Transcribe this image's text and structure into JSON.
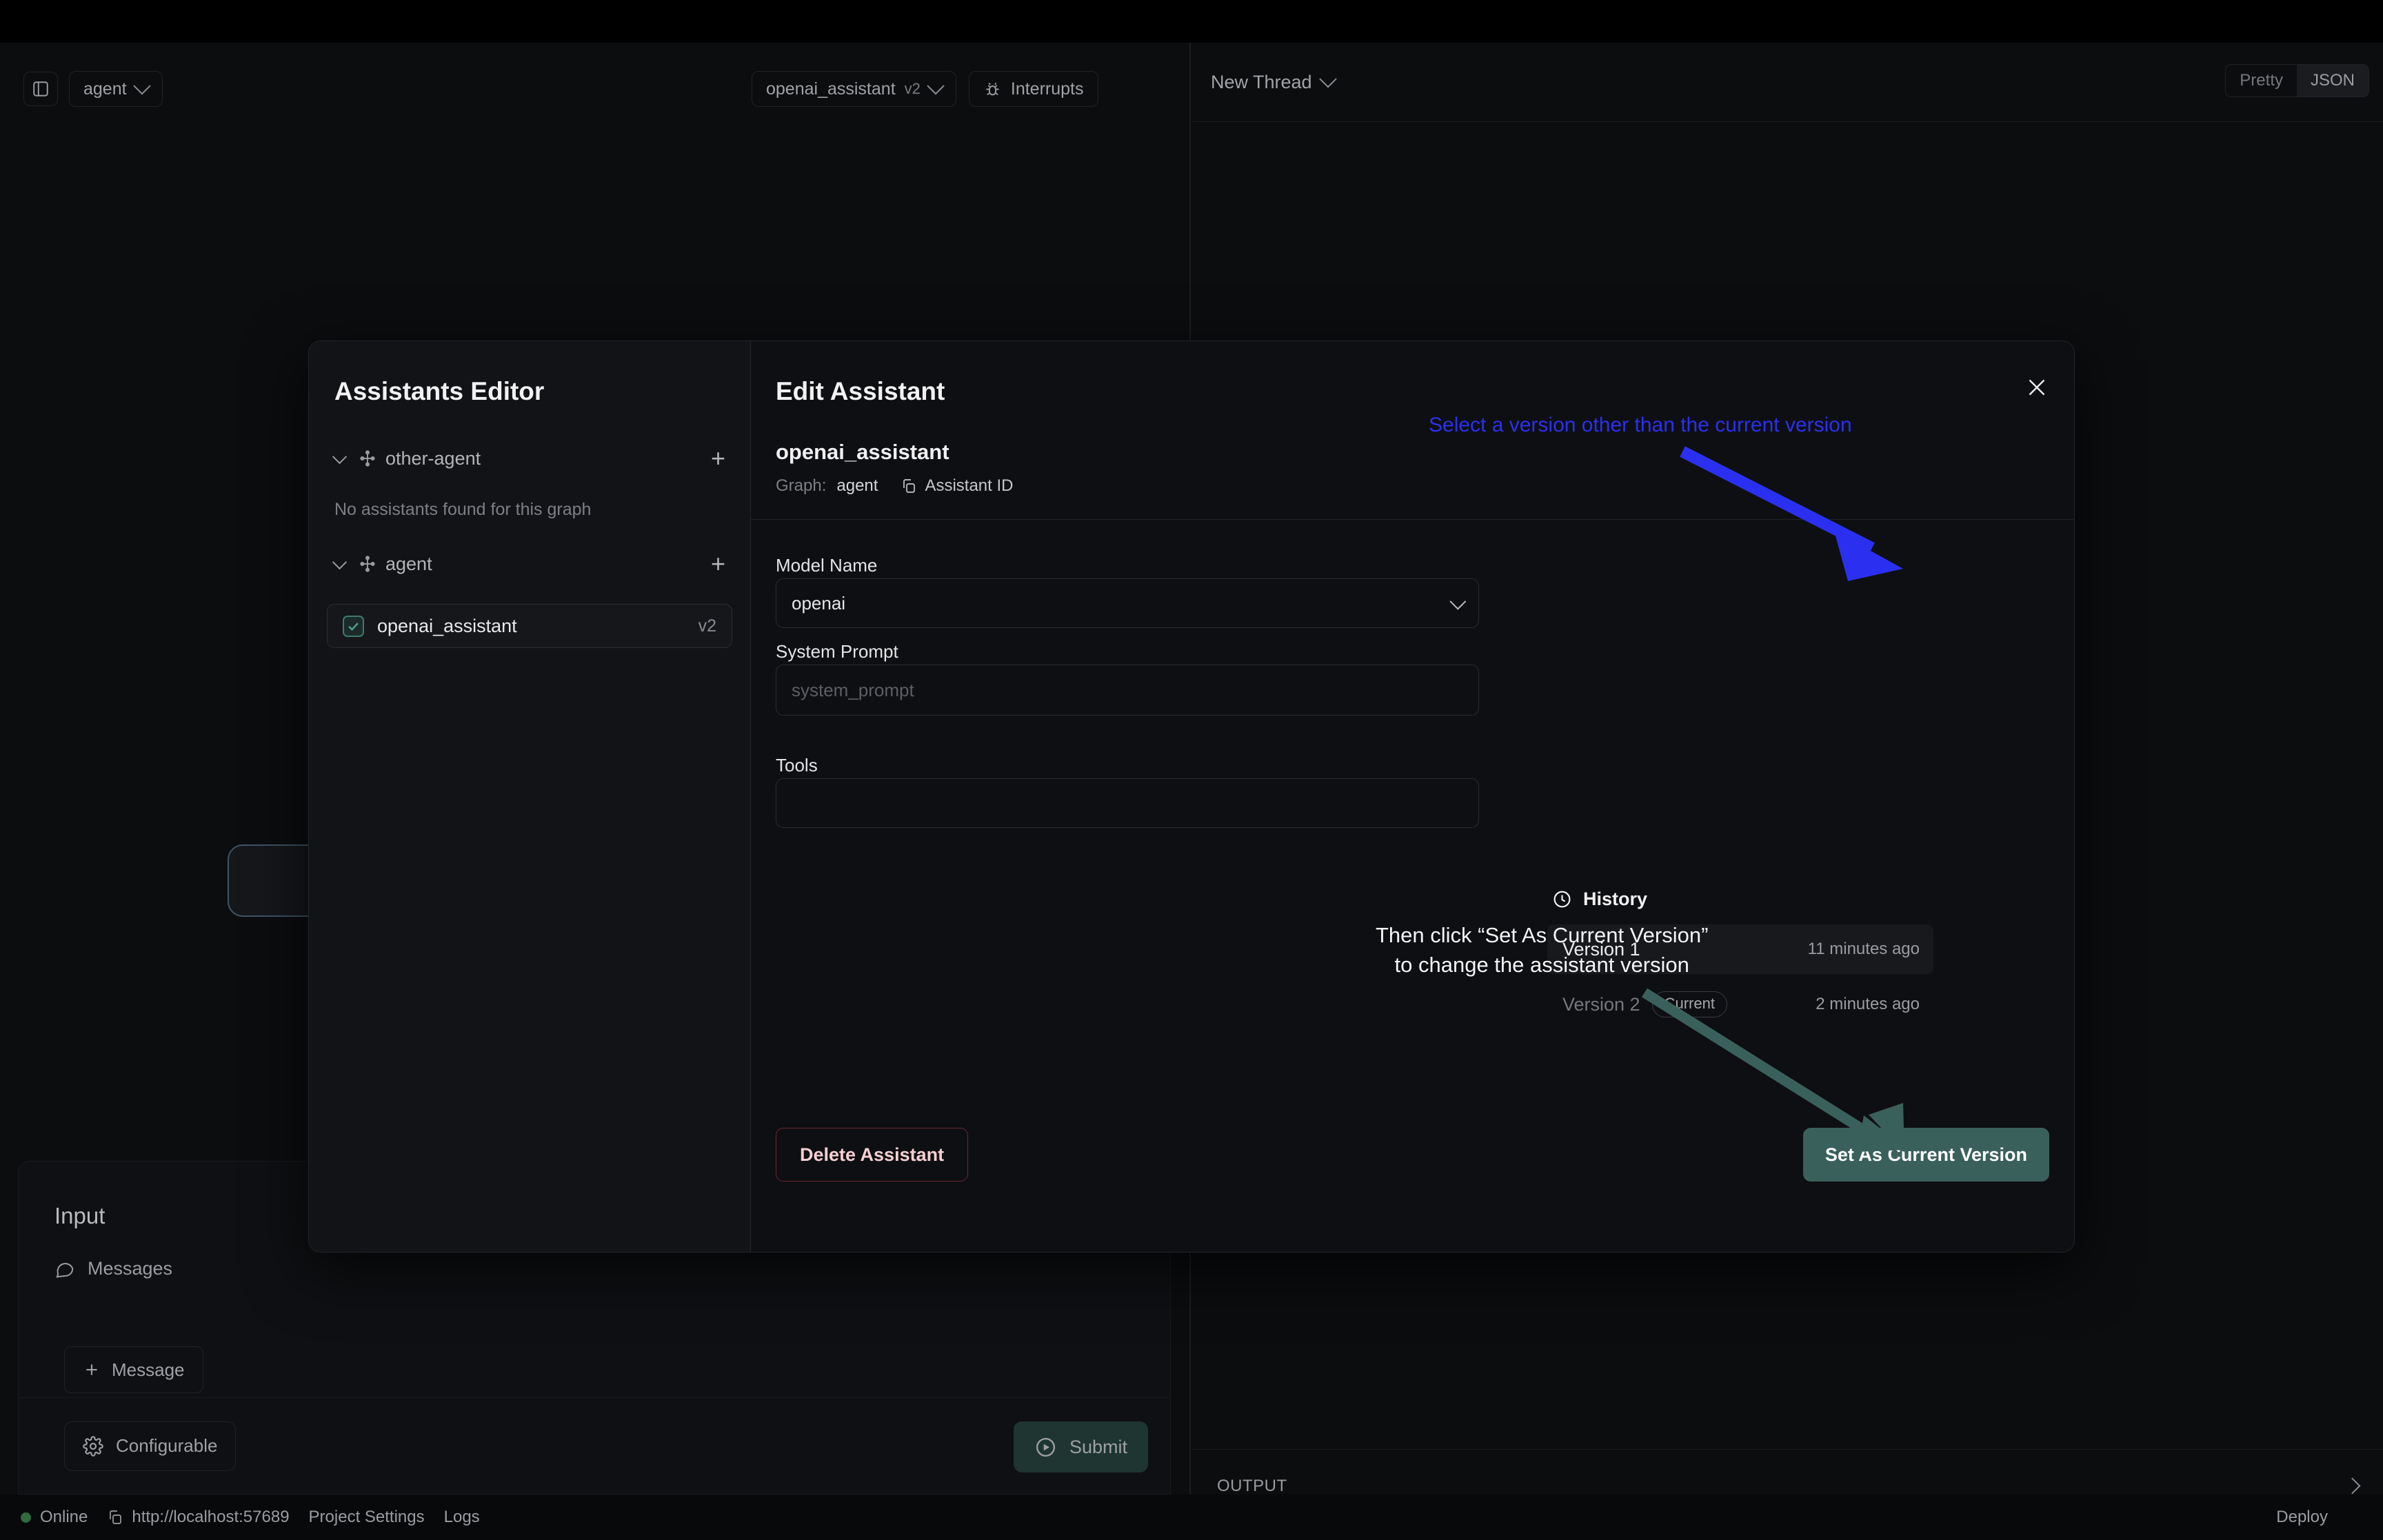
{
  "topbar": {
    "sidebar_toggle_icon": "panel-left-icon",
    "graph_selector": {
      "label": "agent",
      "chevron_icon": "chevron-down-icon"
    },
    "assistant_selector": {
      "label": "openai_assistant",
      "version": "v2",
      "chevron_icon": "chevron-down-icon"
    },
    "interrupts": {
      "label": "Interrupts",
      "icon": "bug-icon"
    },
    "thread": {
      "label": "New Thread",
      "chevron_icon": "chevron-down-icon"
    },
    "view_toggle": {
      "options": [
        "Pretty",
        "JSON"
      ],
      "selected": "JSON"
    }
  },
  "input_panel": {
    "title": "Input",
    "messages_label": "Messages",
    "messages_icon": "chat-bubble-icon",
    "add_message_label": "Message",
    "add_icon": "plus-icon",
    "configurable_label": "Configurable",
    "configurable_icon": "gear-icon",
    "submit_label": "Submit",
    "submit_icon": "play-circle-icon"
  },
  "output_panel": {
    "label": "OUTPUT",
    "expand_icon": "chevron-right-icon"
  },
  "statusbar": {
    "status": "Online",
    "status_color": "#2f6b3e",
    "url": "http://localhost:57689",
    "copy_icon": "copy-icon",
    "project_settings": "Project Settings",
    "logs": "Logs",
    "deploy": "Deploy"
  },
  "modal": {
    "close_icon": "close-icon",
    "sidebar": {
      "title": "Assistants Editor",
      "groups": [
        {
          "name": "other-agent",
          "icon": "graph-icon",
          "twisty_icon": "chevron-down-icon",
          "add_icon": "plus-icon",
          "empty_text": "No assistants found for this graph"
        },
        {
          "name": "agent",
          "icon": "graph-icon",
          "twisty_icon": "chevron-down-icon",
          "add_icon": "plus-icon"
        }
      ],
      "assistants": [
        {
          "name": "openai_assistant",
          "version": "v2",
          "selected": true,
          "check_icon": "check-square-icon"
        }
      ]
    },
    "editor": {
      "title": "Edit Assistant",
      "assistant_name": "openai_assistant",
      "graph_prefix": "Graph:",
      "graph_name": "agent",
      "assistant_id_label": "Assistant ID",
      "assistant_id_icon": "copy-icon",
      "fields": [
        {
          "label": "Model Name",
          "value": "openai",
          "placeholder": "",
          "type": "select",
          "chevron_icon": "chevron-down-icon"
        },
        {
          "label": "System Prompt",
          "value": "",
          "placeholder": "system_prompt",
          "type": "textarea"
        },
        {
          "label": "Tools",
          "value": "",
          "placeholder": "",
          "type": "textarea"
        }
      ],
      "delete_label": "Delete Assistant",
      "set_current_label": "Set As Current Version"
    },
    "history": {
      "title": "History",
      "icon": "clock-icon",
      "rows": [
        {
          "version": "Version 1",
          "badge": "",
          "time": "11 minutes ago",
          "selected": true
        },
        {
          "version": "Version 2",
          "badge": "Current",
          "time": "2 minutes ago",
          "selected": false
        }
      ]
    }
  },
  "annotations": {
    "blue": {
      "text": "Select a version other than the current version",
      "color": "#2b30f0"
    },
    "white_line1": "Then click “Set As Current Version”",
    "white_line2": "to change the assistant version",
    "teal_color": "#3a605b"
  }
}
